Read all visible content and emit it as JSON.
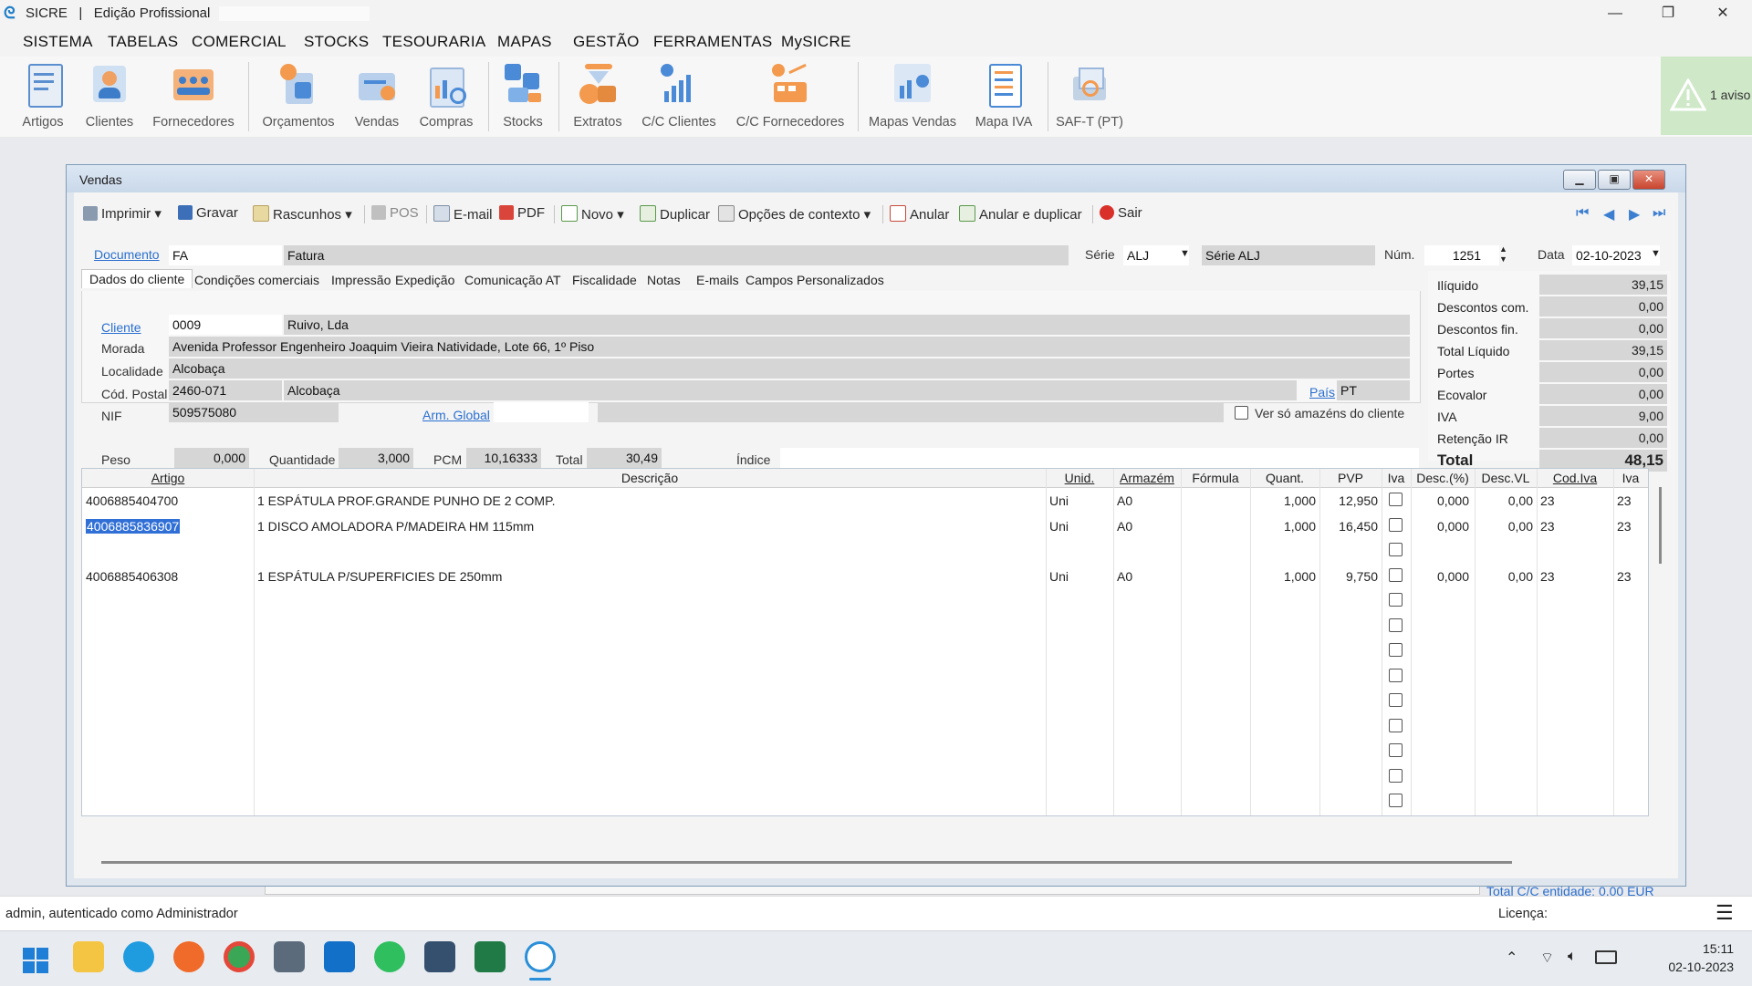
{
  "app": {
    "name": "SICRE",
    "edition": "Edição Profissional",
    "sep": "|"
  },
  "menu": [
    "SISTEMA",
    "TABELAS",
    "COMERCIAL",
    "STOCKS",
    "TESOURARIA",
    "MAPAS",
    "GESTÃO",
    "FERRAMENTAS",
    "MySICRE"
  ],
  "ribbon": [
    "Artigos",
    "Clientes",
    "Fornecedores",
    "Orçamentos",
    "Vendas",
    "Compras",
    "Stocks",
    "Extratos",
    "C/C Clientes",
    "C/C Fornecedores",
    "Mapas Vendas",
    "Mapa IVA",
    "SAF-T (PT)"
  ],
  "warning": "1 aviso",
  "window": {
    "title": "Vendas"
  },
  "toolbar": {
    "imprimir": "Imprimir",
    "gravar": "Gravar",
    "rascunhos": "Rascunhos",
    "pos": "POS",
    "email": "E-mail",
    "pdf": "PDF",
    "novo": "Novo",
    "duplicar": "Duplicar",
    "opcoes": "Opções de contexto",
    "anular": "Anular",
    "anular_duplicar": "Anular e duplicar",
    "sair": "Sair"
  },
  "doc": {
    "documento_label": "Documento",
    "doc_code": "FA",
    "doc_name": "Fatura",
    "serie_label": "Série",
    "serie_code": "ALJ",
    "serie_name": "Série ALJ",
    "num_label": "Núm.",
    "num": "1251",
    "data_label": "Data",
    "date": "02-10-2023"
  },
  "tabs": [
    "Dados do cliente",
    "Condições comerciais",
    "Impressão",
    "Expedição",
    "Comunicação AT",
    "Fiscalidade",
    "Notas",
    "E-mails",
    "Campos Personalizados"
  ],
  "client": {
    "cliente_label": "Cliente",
    "code": "0009",
    "name": "Ruivo, Lda",
    "morada_label": "Morada",
    "address": "Avenida Professor Engenheiro Joaquim Vieira Natividade, Lote 66, 1º Piso",
    "localidade_label": "Localidade",
    "locality": "Alcobaça",
    "cp_label": "Cód. Postal",
    "postal": "2460-071",
    "postal_city": "Alcobaça",
    "pais_label": "País",
    "country": "PT",
    "nif_label": "NIF",
    "nif": "509575080",
    "arm_label": "Arm. Global",
    "ver_so_label": "Ver só amazéns do cliente"
  },
  "summary": {
    "peso_label": "Peso",
    "peso": "0,000",
    "quantidade_label": "Quantidade",
    "quantidade": "3,000",
    "pcm_label": "PCM",
    "pcm": "10,16333",
    "total_label": "Total",
    "total": "30,49",
    "indice_label": "Índice"
  },
  "totals": [
    {
      "label": "Ilíquido",
      "value": "39,15"
    },
    {
      "label": "Descontos com.",
      "value": "0,00"
    },
    {
      "label": "Descontos fin.",
      "value": "0,00"
    },
    {
      "label": "Total Líquido",
      "value": "39,15"
    },
    {
      "label": "Portes",
      "value": "0,00"
    },
    {
      "label": "Ecovalor",
      "value": "0,00"
    },
    {
      "label": "IVA",
      "value": "9,00"
    },
    {
      "label": "Retenção IR",
      "value": "0,00"
    }
  ],
  "grand_total": {
    "label": "Total",
    "value": "48,15"
  },
  "grid": {
    "headers": [
      "Artigo",
      "Descrição",
      "Unid.",
      "Armazém",
      "Fórmula",
      "Quant.",
      "PVP",
      "Iva",
      "Desc.(%)",
      "Desc.VL",
      "Cod.Iva",
      "Iva"
    ],
    "rows": [
      {
        "artigo": "4006885404700",
        "desc": "1 ESPÁTULA PROF.GRANDE PUNHO DE 2 COMP.",
        "unid": "Uni",
        "arm": "A0",
        "quant": "1,000",
        "pvp": "12,950",
        "descp": "0,000",
        "descvl": "0,00",
        "codiva": "23",
        "iva": "23"
      },
      {
        "artigo": "4006885836907",
        "desc": "1 DISCO AMOLADORA P/MADEIRA HM 115mm",
        "unid": "Uni",
        "arm": "A0",
        "quant": "1,000",
        "pvp": "16,450",
        "descp": "0,000",
        "descvl": "0,00",
        "codiva": "23",
        "iva": "23"
      },
      {
        "artigo": "4006885406308",
        "desc": "1 ESPÁTULA P/SUPERFICIES DE 250mm",
        "unid": "Uni",
        "arm": "A0",
        "quant": "1,000",
        "pvp": "9,750",
        "descp": "0,000",
        "descvl": "0,00",
        "codiva": "23",
        "iva": "23"
      }
    ]
  },
  "footer_link": "Total C/C entidade: 0,00 EUR",
  "status": {
    "user": "admin, autenticado como Administrador",
    "licenca": "Licença:"
  },
  "clock": {
    "time": "15:11",
    "date": "02-10-2023"
  }
}
